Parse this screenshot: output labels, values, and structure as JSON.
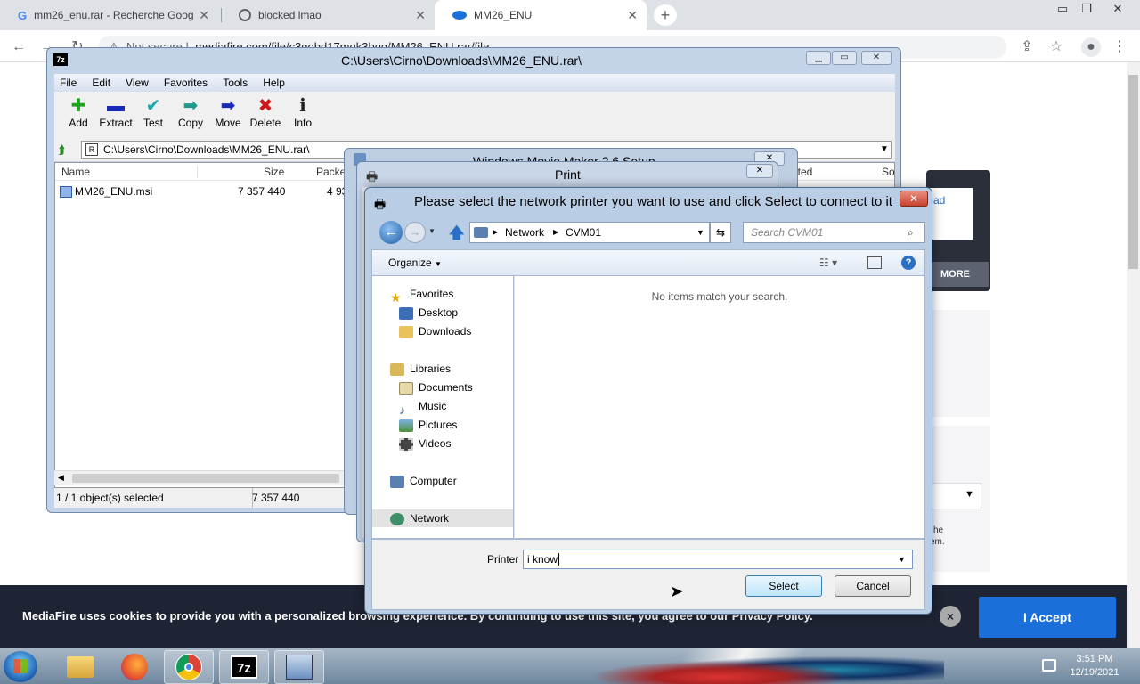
{
  "browser": {
    "tabs": [
      {
        "label": "mm26_enu.rar - Recherche Goog",
        "icon": "google-g-icon"
      },
      {
        "label": "blocked lmao",
        "icon": "globe-icon"
      },
      {
        "label": "MM26_ENU",
        "icon": "mediafire-icon"
      }
    ],
    "address_security": "Not secure",
    "address_url": "mediafire.com/file/c3gobd17mqk3bqg/MM26_ENU.rar/file"
  },
  "page": {
    "side_link": "ad",
    "more_label": "MORE",
    "side_text_1": "he",
    "side_text_2": "em."
  },
  "cookie": {
    "text": "MediaFire uses cookies to provide you with a personalized browsing experience. By continuing to use this site, you agree to our Privacy Policy.",
    "close": "×",
    "accept": "I Accept"
  },
  "sevenzip": {
    "title": "C:\\Users\\Cirno\\Downloads\\MM26_ENU.rar\\",
    "app_icon": "7z",
    "menu": [
      "File",
      "Edit",
      "View",
      "Favorites",
      "Tools",
      "Help"
    ],
    "tools": [
      {
        "label": "Add",
        "glyph": "✚",
        "color": "#1ea31e"
      },
      {
        "label": "Extract",
        "glyph": "▬",
        "color": "#1a2ab8"
      },
      {
        "label": "Test",
        "glyph": "✔",
        "color": "#18a8a8"
      },
      {
        "label": "Copy",
        "glyph": "➡",
        "color": "#1d9a8e"
      },
      {
        "label": "Move",
        "glyph": "➡",
        "color": "#1a2ab8"
      },
      {
        "label": "Delete",
        "glyph": "✖",
        "color": "#d01818"
      },
      {
        "label": "Info",
        "glyph": "ℹ",
        "color": "#222222"
      }
    ],
    "path": "C:\\Users\\Cirno\\Downloads\\MM26_ENU.rar\\",
    "columns": [
      "Name",
      "Size",
      "Packe",
      "pted",
      "So"
    ],
    "rows": [
      {
        "name": "MM26_ENU.msi",
        "size": "7 357 440",
        "packed": "4 93"
      }
    ],
    "status_left": "1 / 1 object(s) selected",
    "status_size": "7 357 440"
  },
  "wmm_title": "Windows Movie Maker 2.6 Setup",
  "print_title": "Print",
  "network_dialog": {
    "title": "Please select the network printer you want to use and click Select to connect to it",
    "breadcrumb": [
      "Network",
      "CVM01"
    ],
    "search_placeholder": "Search CVM01",
    "organize": "Organize",
    "empty_message": "No items match your search.",
    "nav": {
      "favorites": "Favorites",
      "desktop": "Desktop",
      "downloads": "Downloads",
      "libraries": "Libraries",
      "documents": "Documents",
      "music": "Music",
      "pictures": "Pictures",
      "videos": "Videos",
      "computer": "Computer",
      "network": "Network"
    },
    "printer_label": "Printer",
    "printer_value": "i know ",
    "select_label": "Select",
    "cancel_label": "Cancel"
  },
  "taskbar": {
    "time": "3:51 PM",
    "date": "12/19/2021"
  }
}
